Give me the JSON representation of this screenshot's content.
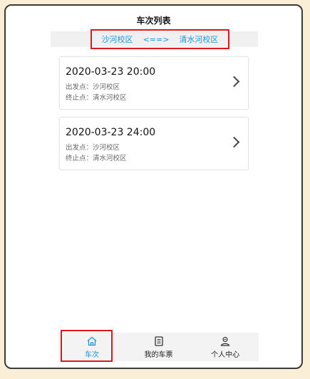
{
  "header": {
    "title": "车次列表"
  },
  "route": {
    "from": "沙河校区",
    "arrow": "<==>",
    "to": "清水河校区"
  },
  "trips": [
    {
      "time": "2020-03-23 20:00",
      "from": "出发点：沙河校区",
      "to": "终止点：清水河校区"
    },
    {
      "time": "2020-03-23 24:00",
      "from": "出发点：沙河校区",
      "to": "终止点：清水河校区"
    }
  ],
  "tabbar": {
    "items": [
      {
        "label": "车次",
        "icon": "home-icon",
        "active": true
      },
      {
        "label": "我的车票",
        "icon": "ticket-icon",
        "active": false
      },
      {
        "label": "个人中心",
        "icon": "user-icon",
        "active": false
      }
    ]
  },
  "colors": {
    "accent": "#2196d6",
    "highlight": "#e0161b",
    "background": "#fbeed6"
  }
}
